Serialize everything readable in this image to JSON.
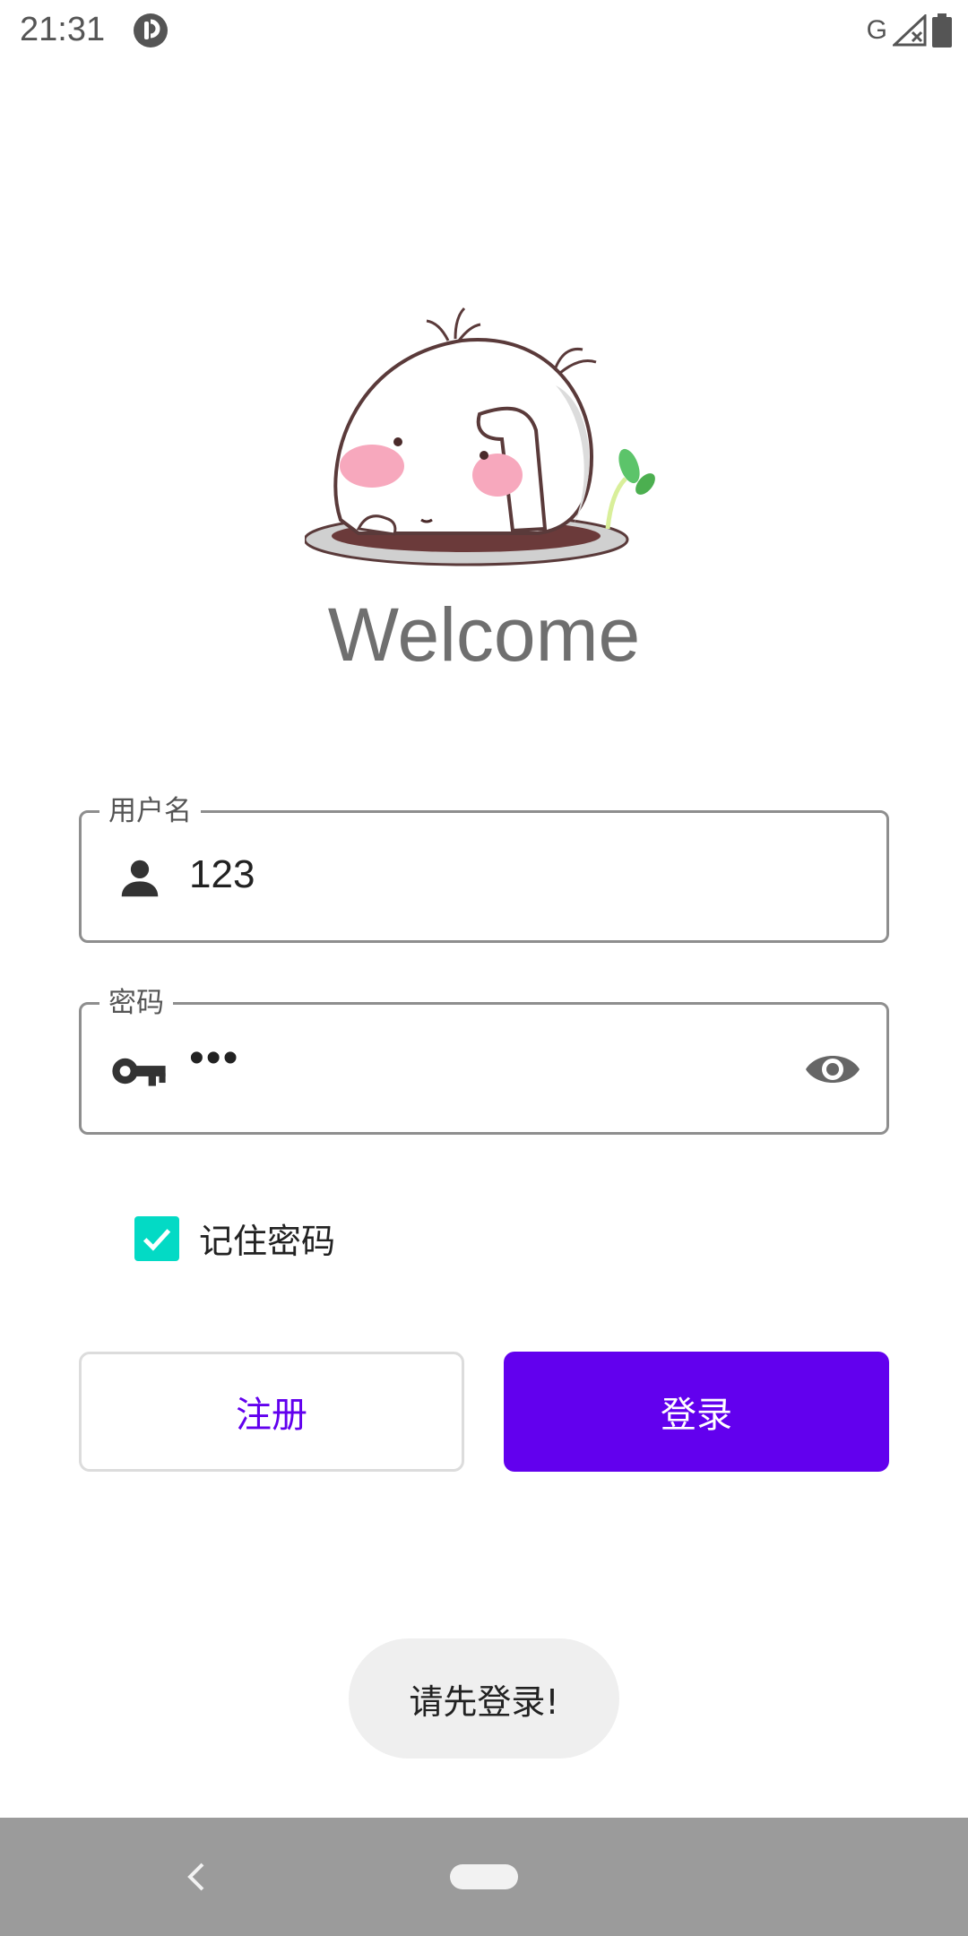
{
  "status_bar": {
    "time": "21:31",
    "network_type": "G",
    "icons": [
      "app-notification-icon",
      "signal-no-data-icon",
      "battery-icon"
    ]
  },
  "header": {
    "welcome_text": "Welcome",
    "mascot": "mascot-illustration"
  },
  "form": {
    "username": {
      "label": "用户名",
      "value": "123",
      "icon": "person-icon"
    },
    "password": {
      "label": "密码",
      "masked_value": "•••",
      "icon": "key-icon",
      "toggle_icon": "eye-icon"
    },
    "remember": {
      "label": "记住密码",
      "checked": true
    }
  },
  "buttons": {
    "register": "注册",
    "login": "登录"
  },
  "toast": {
    "message": "请先登录!"
  },
  "nav_bar": {
    "icons": [
      "back-icon",
      "home-pill"
    ]
  },
  "colors": {
    "primary": "#6200ee",
    "checkbox": "#03dac5",
    "nav_bar": "#9b9b9b",
    "toast_bg": "#efefef"
  }
}
